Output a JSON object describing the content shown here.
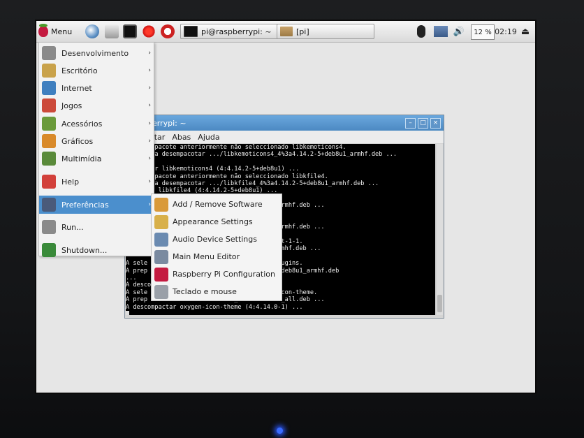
{
  "taskbar": {
    "menu_label": "Menu",
    "tasks": [
      {
        "label": "pi@raspberrypi: ~"
      },
      {
        "label": "[pi]"
      }
    ],
    "tray": {
      "cpu": "12 %",
      "clock": "02:19"
    }
  },
  "terminal": {
    "title": "raspberrypi: ~",
    "menus": [
      "o",
      "Editar",
      "Abas",
      "Ajuda"
    ],
    "lines": [
      "ecionar pacote anteriormente não seleccionado libkemoticons4.",
      "arar para desempacotar .../libkemoticons4_4%3a4.14.2-5+deb8u1_armhf.deb ...",
      "",
      "compactar libkemoticons4 (4:4.14.2-5+deb8u1) ...",
      "ecionar pacote anteriormente não seleccionado libkfile4.",
      "arar para desempacotar .../libkfile4_4%3a4.14.2-5+deb8u1_armhf.deb ...",
      "ompactar libkfile4 (4:4.14.2-5+deb8u1) ...",
      "                    eleccionado libkhtml5.",
      "                    5_4%3a4.14.2-5+deb8u1_armhf.deb ...",
      "                    u1) ...",
      "                    eleccionado libkntlm4.",
      "                    4_4%3a4.14.2-5+deb8u1_armhf.deb ...",
      "                    u1) ...",
      "                    eleccionado libpolkit-qt-1-1.",
      "                    kit-qt-1-1_0.103.0-1_armhf.deb ...",
      "                    1) ...",
      "A sele              eleccionado kdelibs5-plugins.",
      "A prep              5-plugins_4%3a4.14.2-5+deb8u1_armhf.deb",
      "...",
      "A desco             2-5+deb8u1) ...",
      "A sele              e seleccionado oxygen-icon-theme.",
      "A prep              icon-theme_4%3a4.14.0-1_all.deb ...",
      "A descompactar oxygen-icon-theme (4:4.14.0-1) ..."
    ]
  },
  "main_menu": {
    "items": [
      {
        "label": "Desenvolvimento",
        "icon": "development-icon",
        "color": "#8a8a8a"
      },
      {
        "label": "Escritório",
        "icon": "office-icon",
        "color": "#c9a24a"
      },
      {
        "label": "Internet",
        "icon": "globe-icon",
        "color": "#3f7fbf"
      },
      {
        "label": "Jogos",
        "icon": "games-icon",
        "color": "#cc4a3a"
      },
      {
        "label": "Acessórios",
        "icon": "accessories-icon",
        "color": "#6a9a3a"
      },
      {
        "label": "Gráficos",
        "icon": "graphics-icon",
        "color": "#d98a2a"
      },
      {
        "label": "Multimídia",
        "icon": "multimedia-icon",
        "color": "#5a8a3a"
      },
      {
        "label": "Help",
        "icon": "help-icon",
        "color": "#d2403a"
      },
      {
        "label": "Preferências",
        "icon": "preferences-icon",
        "color": "#4a5a7a",
        "highlighted": true
      },
      {
        "label": "Run...",
        "icon": "run-icon",
        "color": "#8a8a8a"
      },
      {
        "label": "Shutdown...",
        "icon": "shutdown-icon",
        "color": "#3a8a3a"
      }
    ]
  },
  "submenu": {
    "items": [
      {
        "label": "Add / Remove Software",
        "icon": "package-icon",
        "color": "#d99a3a"
      },
      {
        "label": "Appearance Settings",
        "icon": "appearance-icon",
        "color": "#d8b04a"
      },
      {
        "label": "Audio Device Settings",
        "icon": "audio-icon",
        "color": "#6a8ab0"
      },
      {
        "label": "Main Menu Editor",
        "icon": "menu-editor-icon",
        "color": "#7a8aa0"
      },
      {
        "label": "Raspberry Pi Configuration",
        "icon": "raspberry-icon",
        "color": "#c41a40"
      },
      {
        "label": "Teclado e mouse",
        "icon": "keyboard-mouse-icon",
        "color": "#9aa0a8"
      }
    ]
  }
}
